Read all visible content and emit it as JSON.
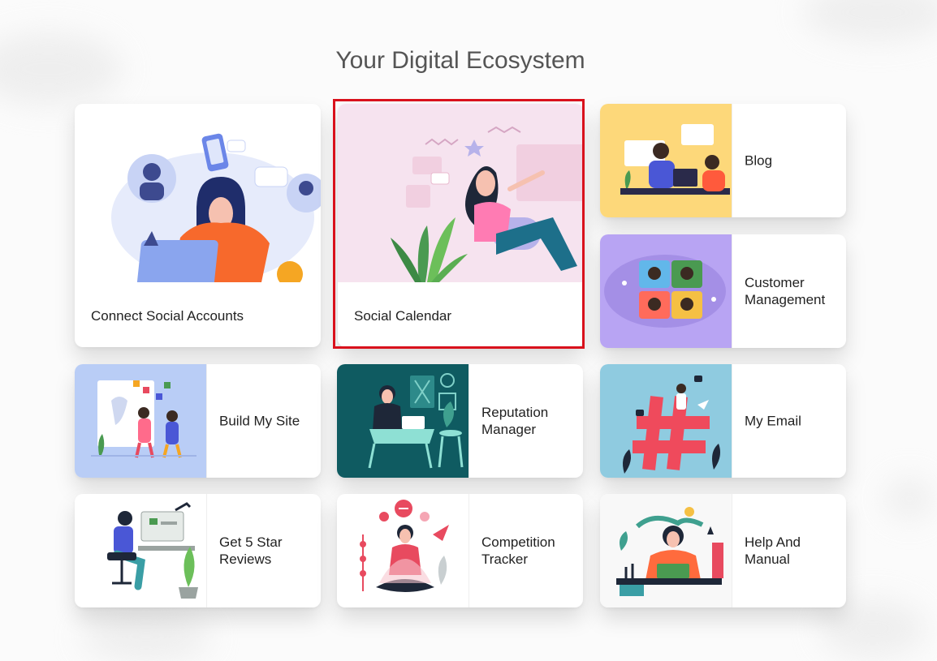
{
  "page": {
    "title": "Your Digital Ecosystem"
  },
  "cards": {
    "connect_social": {
      "label": "Connect Social Accounts",
      "bg": "#ffffff"
    },
    "social_calendar": {
      "label": "Social Calendar",
      "bg": "#f6e3ef"
    },
    "blog": {
      "label": "Blog",
      "bg": "#fdd87a"
    },
    "customer_management": {
      "label": "Customer Management",
      "bg": "#b8a4f3"
    },
    "build_my_site": {
      "label": "Build My Site",
      "bg": "#b9cdf6"
    },
    "reputation_manager": {
      "label": "Reputation Manager",
      "bg": "#0f5b61"
    },
    "my_email": {
      "label": "My Email",
      "bg": "#8fcbe0"
    },
    "get_5_star_reviews": {
      "label": "Get 5 Star Reviews",
      "bg": "#ffffff"
    },
    "competition_tracker": {
      "label": "Competition Tracker",
      "bg": "#ffffff"
    },
    "help_and_manual": {
      "label": "Help And Manual",
      "bg": "#ffffff"
    }
  },
  "selection": {
    "selected_card": "social_calendar",
    "outline_color": "#d9111c"
  }
}
